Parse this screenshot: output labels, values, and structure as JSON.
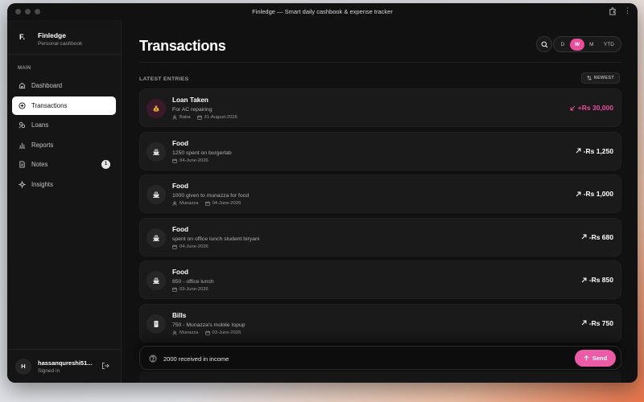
{
  "window": {
    "title": "Finledge — Smart daily cashbook & expense tracker"
  },
  "brand": {
    "logo": "F.",
    "name": "Finledge",
    "subtitle": "Personal cashbook"
  },
  "sidebar": {
    "section_label": "MAIN",
    "items": [
      {
        "label": "Dashboard",
        "icon": "home-icon",
        "active": false
      },
      {
        "label": "Transactions",
        "icon": "plus-circle-icon",
        "active": true
      },
      {
        "label": "Loans",
        "icon": "loans-icon",
        "active": false
      },
      {
        "label": "Reports",
        "icon": "bar-chart-icon",
        "active": false
      },
      {
        "label": "Notes",
        "icon": "note-icon",
        "active": false,
        "badge": "1"
      },
      {
        "label": "Insights",
        "icon": "sparkle-icon",
        "active": false
      }
    ]
  },
  "user": {
    "initial": "H",
    "name": "hassanqureshi51...",
    "status": "Signed in"
  },
  "header": {
    "title": "Transactions",
    "periods": [
      {
        "label": "D",
        "active": false
      },
      {
        "label": "W",
        "active": true
      },
      {
        "label": "M",
        "active": false
      },
      {
        "label": "YTD",
        "active": false
      }
    ]
  },
  "list": {
    "section_label": "LATEST ENTRIES",
    "sort_label": "NEWEST",
    "entries": [
      {
        "title": "Loan Taken",
        "desc": "For AC repairing",
        "person": "Baba",
        "date": "31-August-2026",
        "amount": "+Rs 30,000",
        "type": "income",
        "icon": "money-bag-icon"
      },
      {
        "title": "Food",
        "desc": "1250 spent on burgerlab",
        "person": "",
        "date": "04-June-2026",
        "amount": "-Rs 1,250",
        "type": "expense",
        "icon": "food-icon"
      },
      {
        "title": "Food",
        "desc": "1000 given to munazza for food",
        "person": "Munazza",
        "date": "04-June-2026",
        "amount": "-Rs 1,000",
        "type": "expense",
        "icon": "food-icon"
      },
      {
        "title": "Food",
        "desc": "spent on office lunch student biryani",
        "person": "",
        "date": "04-June-2026",
        "amount": "-Rs 680",
        "type": "expense",
        "icon": "food-icon"
      },
      {
        "title": "Food",
        "desc": "850 - office lunch",
        "person": "",
        "date": "03-June-2026",
        "amount": "-Rs 850",
        "type": "expense",
        "icon": "food-icon"
      },
      {
        "title": "Bills",
        "desc": "750 - Munazza's mobile topup",
        "person": "Munazza",
        "date": "03-June-2026",
        "amount": "-Rs 750",
        "type": "expense",
        "icon": "bill-icon"
      }
    ]
  },
  "composer": {
    "value": "2000 received in income",
    "send_label": "Send"
  },
  "colors": {
    "accent": "#e94e9a",
    "background": "#111111",
    "card": "#1a1a1a"
  }
}
